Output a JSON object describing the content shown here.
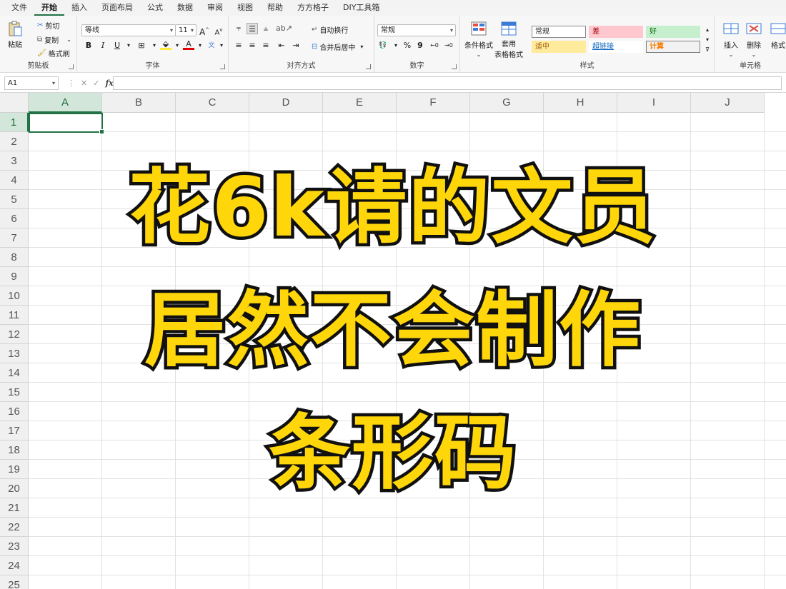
{
  "menu": [
    "文件",
    "开始",
    "插入",
    "页面布局",
    "公式",
    "数据",
    "审阅",
    "视图",
    "帮助",
    "方方格子",
    "DIY工具箱"
  ],
  "active_menu_index": 1,
  "ribbon": {
    "clipboard": {
      "paste": "粘贴",
      "cut": "剪切",
      "copy": "复制",
      "format_painter": "格式刷",
      "label": "剪贴板"
    },
    "font": {
      "name": "等线",
      "size": "11",
      "bold": "B",
      "italic": "I",
      "underline": "U",
      "grow": "A",
      "shrink": "A",
      "font_color": "A",
      "phonetic": "文",
      "label": "字体"
    },
    "alignment": {
      "wrap": "自动换行",
      "merge": "合并后居中",
      "label": "对齐方式"
    },
    "number": {
      "format": "常规",
      "percent": "%",
      "comma": "9",
      "label": "数字"
    },
    "styles": {
      "conditional": "条件格式",
      "table_format_1": "套用",
      "table_format_2": "表格格式",
      "cells": [
        {
          "text": "常规",
          "bg": "#ffffff",
          "color": "#222222",
          "border": "#8a8a8a"
        },
        {
          "text": "差",
          "bg": "#ffc7ce",
          "color": "#9c0006",
          "border": "#ffc7ce"
        },
        {
          "text": "好",
          "bg": "#c6efce",
          "color": "#006100",
          "border": "#c6efce"
        },
        {
          "text": "适中",
          "bg": "#ffeb9c",
          "color": "#9c5700",
          "border": "#ffeb9c"
        },
        {
          "text": "超链接",
          "bg": "#ffffff",
          "color": "#0563c1",
          "border": "#ffffff"
        },
        {
          "text": "计算",
          "bg": "#f2f2f2",
          "color": "#fa7d00",
          "border": "#7f7f7f"
        }
      ],
      "label": "样式"
    },
    "cells": {
      "insert": "插入",
      "delete": "删除",
      "format": "格式",
      "label": "单元格"
    }
  },
  "formula_bar": {
    "name_box": "A1",
    "fx": "fx",
    "cancel": "✕",
    "enter": "✓",
    "value": ""
  },
  "grid": {
    "columns": [
      "A",
      "B",
      "C",
      "D",
      "E",
      "F",
      "G",
      "H",
      "I",
      "J"
    ],
    "rows": [
      "1",
      "2",
      "3",
      "4",
      "5",
      "6",
      "7",
      "8",
      "9",
      "10",
      "11",
      "12",
      "13",
      "14",
      "15",
      "16",
      "17",
      "18",
      "19",
      "20",
      "21",
      "22",
      "23",
      "24",
      "25"
    ],
    "selected_column": "A",
    "selected_row": "1"
  },
  "headline": {
    "line1": "花6k请的文员",
    "line2": "居然不会制作",
    "line3": "条形码",
    "fill": "#ffd60a",
    "stroke": "#111111"
  },
  "accent": "#217346"
}
